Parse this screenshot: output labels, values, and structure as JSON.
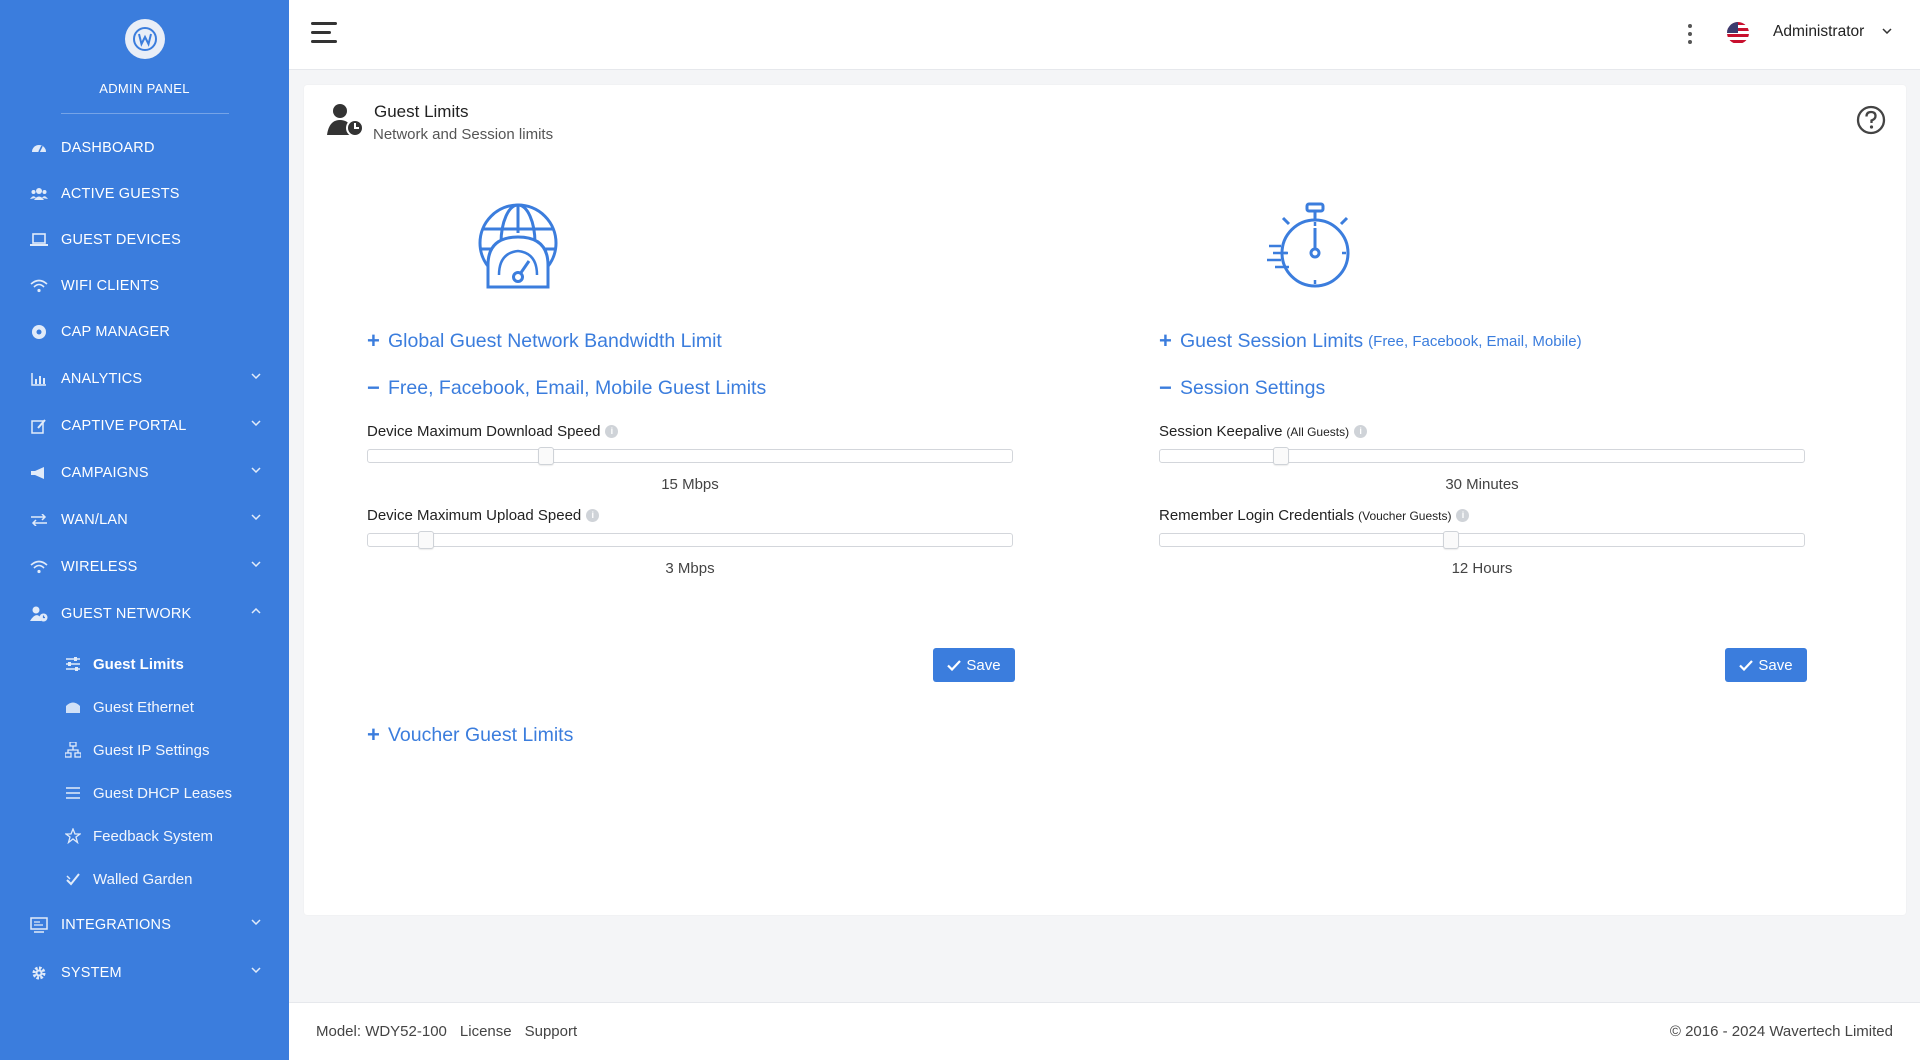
{
  "sidebar": {
    "brand": "ADMIN PANEL",
    "items": [
      {
        "label": "DASHBOARD",
        "icon": "dashboard-icon"
      },
      {
        "label": "ACTIVE GUESTS",
        "icon": "users-icon"
      },
      {
        "label": "GUEST DEVICES",
        "icon": "laptop-icon"
      },
      {
        "label": "WIFI CLIENTS",
        "icon": "wifi-icon"
      },
      {
        "label": "CAP MANAGER",
        "icon": "circle-icon"
      },
      {
        "label": "ANALYTICS",
        "icon": "chart-icon"
      },
      {
        "label": "CAPTIVE PORTAL",
        "icon": "edit-icon"
      },
      {
        "label": "CAMPAIGNS",
        "icon": "megaphone-icon"
      },
      {
        "label": "WAN/LAN",
        "icon": "arrows-icon"
      },
      {
        "label": "WIRELESS",
        "icon": "wifi-icon"
      },
      {
        "label": "GUEST NETWORK",
        "icon": "user-clock-icon"
      },
      {
        "label": "INTEGRATIONS",
        "icon": "monitor-icon"
      },
      {
        "label": "SYSTEM",
        "icon": "gear-icon"
      }
    ],
    "subitems": [
      {
        "label": "Guest Limits",
        "icon": "sliders-icon"
      },
      {
        "label": "Guest Ethernet",
        "icon": "ethernet-icon"
      },
      {
        "label": "Guest IP Settings",
        "icon": "network-icon"
      },
      {
        "label": "Guest DHCP Leases",
        "icon": "list-icon"
      },
      {
        "label": "Feedback System",
        "icon": "star-icon"
      },
      {
        "label": "Walled Garden",
        "icon": "shield-check-icon"
      }
    ]
  },
  "topbar": {
    "user": "Administrator"
  },
  "page": {
    "title": "Guest Limits",
    "subtitle": "Network and Session limits"
  },
  "left": {
    "global_toggle": "Global Guest Network Bandwidth Limit",
    "free_toggle": "Free, Facebook, Email, Mobile Guest Limits",
    "download_label": "Device Maximum Download Speed",
    "download_value": "15 Mbps",
    "download_fraction": 0.27,
    "upload_label": "Device Maximum Upload Speed",
    "upload_value": "3 Mbps",
    "upload_fraction": 0.08,
    "save": "Save",
    "voucher_toggle": "Voucher Guest Limits"
  },
  "right": {
    "session_toggle": "Guest Session Limits",
    "session_toggle_note": "(Free, Facebook, Email, Mobile)",
    "settings_toggle": "Session Settings",
    "keepalive_label": "Session Keepalive",
    "keepalive_note": "(All Guests)",
    "keepalive_value": "30 Minutes",
    "keepalive_fraction": 0.18,
    "remember_label": "Remember Login Credentials",
    "remember_note": "(Voucher Guests)",
    "remember_value": "12 Hours",
    "remember_fraction": 0.45,
    "save": "Save"
  },
  "footer": {
    "model": "Model: WDY52-100",
    "license": "License",
    "support": "Support",
    "copyright": "© 2016 - 2024 Wavertech Limited"
  },
  "colors": {
    "accent": "#3b7ddd"
  }
}
